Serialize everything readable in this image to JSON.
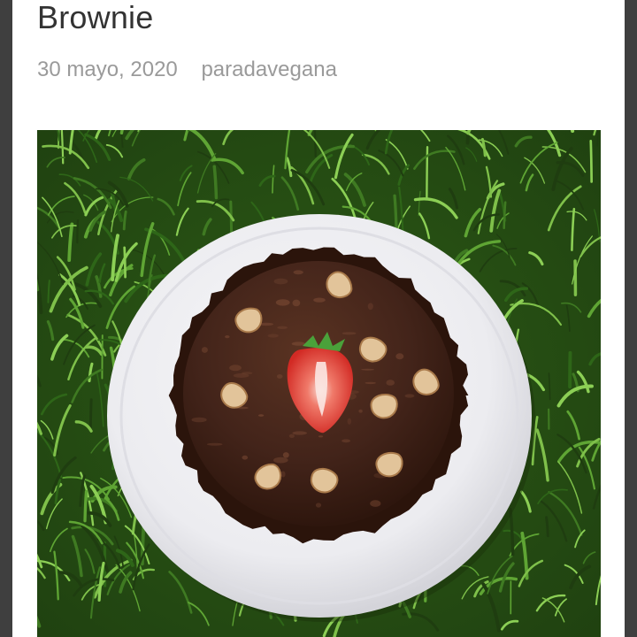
{
  "post": {
    "title": "Brownie",
    "date": "30 mayo, 2020",
    "author": "paradavegana"
  },
  "image": {
    "subject": "brownie-on-plate-photo",
    "colors": {
      "grass_dark": "#1f3d10",
      "grass_mid": "#3f7a22",
      "grass_light": "#7fc04a",
      "plate": "#f1f1f4",
      "brownie": "#3a1e12",
      "glaze": "#4a2818",
      "strawberry": "#e2342f",
      "walnut": "#e2c49a"
    }
  }
}
